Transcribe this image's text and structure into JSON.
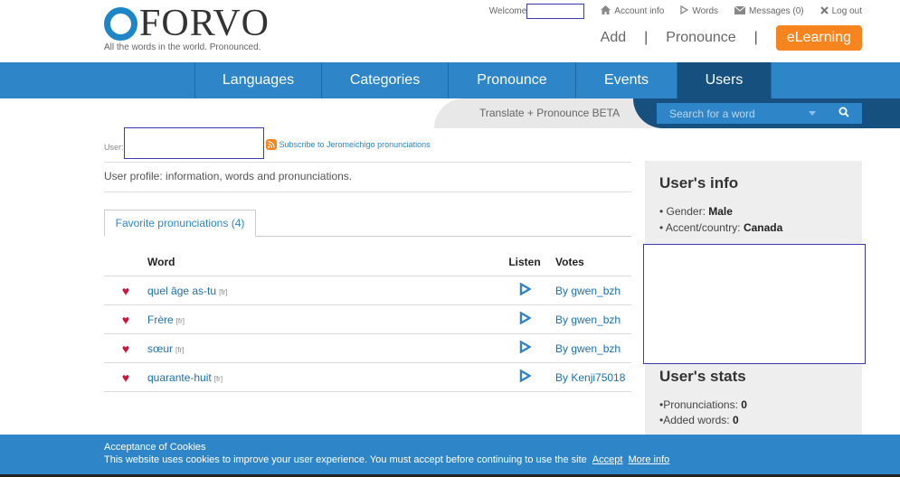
{
  "header": {
    "logo_text": "FORVO",
    "tagline": "All the words in the world. Pronounced.",
    "welcome_label": "Welcome",
    "account_info": "Account info",
    "words": "Words",
    "messages": "Messages (0)",
    "logout": "Log out",
    "add": "Add",
    "pronounce": "Pronounce",
    "elearning": "eLearning",
    "separator": "|"
  },
  "nav": {
    "items": [
      {
        "label": "Languages",
        "active": false
      },
      {
        "label": "Categories",
        "active": false
      },
      {
        "label": "Pronounce",
        "active": false
      },
      {
        "label": "Events",
        "active": false
      },
      {
        "label": "Users",
        "active": true
      }
    ]
  },
  "search": {
    "translate_label": "Translate + Pronounce BETA",
    "placeholder": "Search for a word"
  },
  "profile": {
    "user_label": "User:",
    "subscribe": "Subscribe to Jeromeichigo pronunciations",
    "description": "User profile: information, words and pronunciations.",
    "tab": "Favorite pronunciations (4)"
  },
  "table": {
    "headers": {
      "word": "Word",
      "listen": "Listen",
      "votes": "Votes"
    },
    "rows": [
      {
        "word": "quel âge as-tu",
        "lang": "[fr]",
        "votes": "By gwen_bzh"
      },
      {
        "word": "Frère",
        "lang": "[fr]",
        "votes": "By gwen_bzh"
      },
      {
        "word": "sœur",
        "lang": "[fr]",
        "votes": "By gwen_bzh"
      },
      {
        "word": "quarante-huit",
        "lang": "[fr]",
        "votes": "By Kenji75018"
      }
    ]
  },
  "sidebar": {
    "info_title": "User's info",
    "gender_label": "Gender:",
    "gender_value": "Male",
    "accent_label": "Accent/country:",
    "accent_value": "Canada",
    "stats_title": "User's stats",
    "pronunciations_label": "Pronunciations:",
    "pronunciations_value": "0",
    "added_words_label": "Added words:",
    "added_words_value": "0"
  },
  "cookie": {
    "title": "Acceptance of Cookies",
    "text": "This website uses cookies to improve your user experience. You must accept before continuing to use the site",
    "accept": "Accept",
    "more_info": "More info"
  },
  "colors": {
    "brand_blue": "#2e86c8",
    "dark_blue": "#15507f",
    "orange": "#f6851f",
    "heart": "#c8163c"
  }
}
